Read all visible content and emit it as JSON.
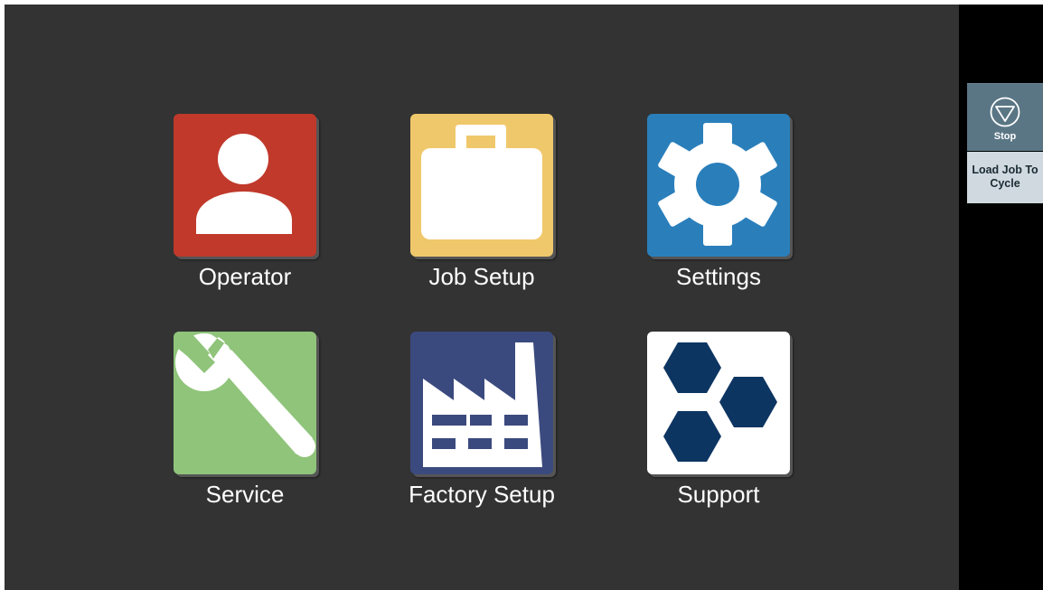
{
  "menu": {
    "tiles": [
      {
        "label": "Operator",
        "icon": "person-icon",
        "color": "#c0392b"
      },
      {
        "label": "Job Setup",
        "icon": "briefcase-icon",
        "color": "#f0c86c"
      },
      {
        "label": "Settings",
        "icon": "gear-icon",
        "color": "#2a7fbb"
      },
      {
        "label": "Service",
        "icon": "wrench-icon",
        "color": "#8fc47a"
      },
      {
        "label": "Factory Setup",
        "icon": "factory-icon",
        "color": "#3b4a7e"
      },
      {
        "label": "Support",
        "icon": "hexagons-icon",
        "color": "#ffffff"
      }
    ]
  },
  "side_panel": {
    "stop_label": "Stop",
    "stop_icon": "stop-triangle-icon",
    "load_job_label": "Load Job To Cycle"
  },
  "colors": {
    "background": "#333333",
    "side_panel": "#000000",
    "stop_button": "#5a7685",
    "load_button": "#cfd9df",
    "support_hex": "#0d3562"
  }
}
